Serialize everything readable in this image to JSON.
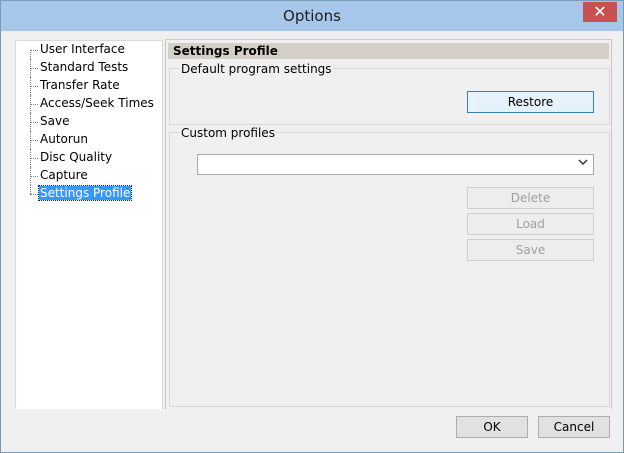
{
  "window": {
    "title": "Options",
    "close_glyph": "✕"
  },
  "sidebar": {
    "items": [
      {
        "label": "User Interface"
      },
      {
        "label": "Standard Tests"
      },
      {
        "label": "Transfer Rate"
      },
      {
        "label": "Access/Seek Times"
      },
      {
        "label": "Save"
      },
      {
        "label": "Autorun"
      },
      {
        "label": "Disc Quality"
      },
      {
        "label": "Capture"
      },
      {
        "label": "Settings Profile",
        "selected": true
      }
    ]
  },
  "panel": {
    "title": "Settings Profile",
    "default_group": {
      "label": "Default program settings",
      "restore_label": "Restore"
    },
    "custom_group": {
      "label": "Custom profiles",
      "combo_value": "",
      "delete_label": "Delete",
      "load_label": "Load",
      "save_label": "Save"
    }
  },
  "footer": {
    "ok_label": "OK",
    "cancel_label": "Cancel"
  },
  "icons": {
    "combo_arrow": "chevron-down-icon",
    "close": "close-icon"
  }
}
